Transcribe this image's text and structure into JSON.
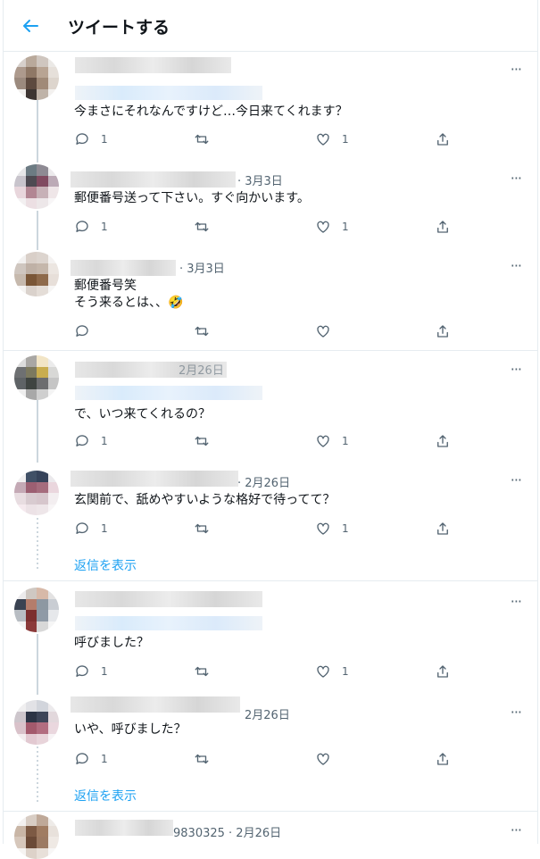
{
  "header": {
    "back_icon": "arrow-left-icon",
    "title": "ツイートする"
  },
  "more_icon_text": "···",
  "show_replies": "返信を表示",
  "tweets": [
    {
      "meta": "",
      "text": "今まさにそれなんですけど…今日来てくれます？",
      "reply": "1",
      "retweet": "",
      "like": "1"
    },
    {
      "meta": "· 3月3日",
      "text": "郵便番号送って下さい。すぐ向かいます。",
      "reply": "1",
      "retweet": "",
      "like": "1"
    },
    {
      "meta": "· 3月3日",
      "text": "郵便番号笑\nそう来るとは、、🤣",
      "reply": "",
      "retweet": "",
      "like": ""
    },
    {
      "meta": "2月26日",
      "text": "で、いつ来てくれるの？",
      "reply": "1",
      "retweet": "",
      "like": "1"
    },
    {
      "meta": "· 2月26日",
      "text": "玄関前で、舐めやすいような格好で待ってて？",
      "reply": "1",
      "retweet": "",
      "like": "1"
    },
    {
      "meta": "",
      "text": "呼びました？",
      "reply": "1",
      "retweet": "",
      "like": "1"
    },
    {
      "meta": "2月26日",
      "text": "いや、呼びました？",
      "reply": "1",
      "retweet": "",
      "like": ""
    },
    {
      "meta": "9830325 · 2月26日",
      "text": "",
      "reply": "",
      "retweet": "",
      "like": ""
    }
  ],
  "colors": {
    "accent": "#1da1f2",
    "muted": "#536471",
    "border": "#e6ecf0"
  }
}
